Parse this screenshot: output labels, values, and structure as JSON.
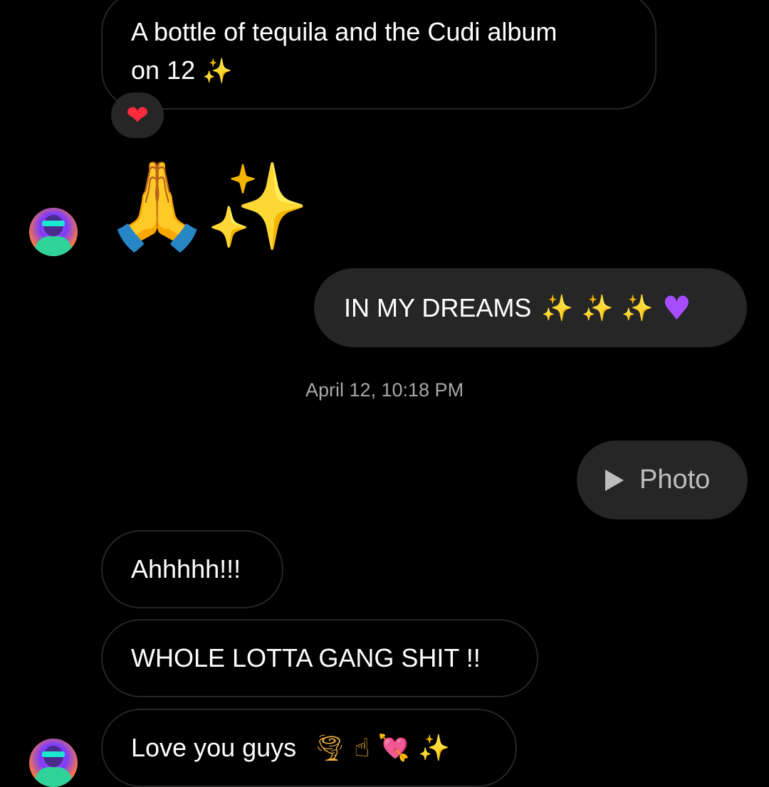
{
  "messages": {
    "m1": {
      "line1": "A bottle of tequila and the Cudi album",
      "line2": "on 12",
      "emoji": "✨"
    },
    "m1_reaction": "❤",
    "m2_emoji_hands": "🙏",
    "m2_emoji_sparkles": "✨",
    "m3": {
      "text": "IN MY DREAMS",
      "sparkles": "✨ ✨ ✨",
      "heart": "♥"
    },
    "timestamp": "April 12, 10:18 PM",
    "m4": {
      "icon": "play-icon",
      "label": "Photo"
    },
    "m5": {
      "text": "Ahhhhh!!!"
    },
    "m6": {
      "text": "WHOLE LOTTA GANG SHIT !!"
    },
    "m7": {
      "text": "Love you guys",
      "emojis": "🌪 ☝ 💘 ✨"
    }
  },
  "colors": {
    "background": "#000000",
    "incoming_border": "#262626",
    "outgoing_bg": "#262626",
    "timestamp": "#a8a8a8",
    "photo_label": "#bdbdbd"
  }
}
